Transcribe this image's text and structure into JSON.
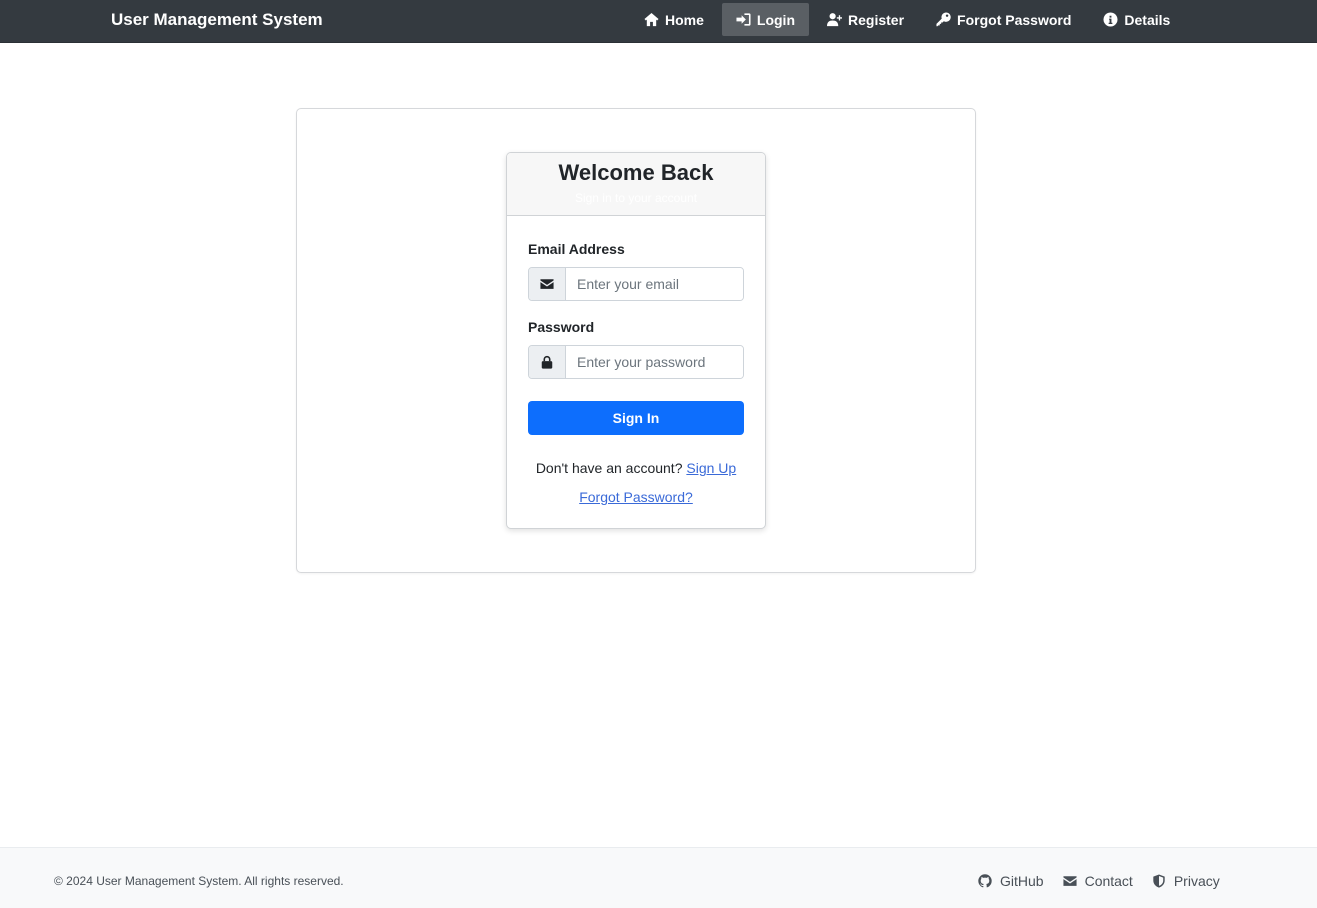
{
  "navbar": {
    "brand": "User Management System",
    "items": [
      {
        "label": "Home",
        "icon": "home-icon",
        "active": false
      },
      {
        "label": "Login",
        "icon": "sign-in-icon",
        "active": true
      },
      {
        "label": "Register",
        "icon": "user-plus-icon",
        "active": false
      },
      {
        "label": "Forgot Password",
        "icon": "key-icon",
        "active": false
      },
      {
        "label": "Details",
        "icon": "info-icon",
        "active": false
      }
    ]
  },
  "login": {
    "title": "Welcome Back",
    "subtitle": "Sign in to your account",
    "email_label": "Email Address",
    "email_placeholder": "Enter your email",
    "email_value": "",
    "password_label": "Password",
    "password_placeholder": "Enter your password",
    "password_value": "",
    "submit_label": "Sign In",
    "signup_prompt": "Don't have an account?",
    "signup_link": "Sign Up",
    "forgot_link": "Forgot Password?"
  },
  "footer": {
    "copyright": "© 2024 User Management System. All rights reserved.",
    "links": [
      {
        "label": "GitHub",
        "icon": "github-icon"
      },
      {
        "label": "Contact",
        "icon": "envelope-icon"
      },
      {
        "label": "Privacy",
        "icon": "shield-icon"
      }
    ]
  },
  "colors": {
    "navbar_bg": "#343a40",
    "primary": "#0d6efd",
    "link": "#3a6ad8",
    "footer_bg": "#f8f9fa"
  }
}
